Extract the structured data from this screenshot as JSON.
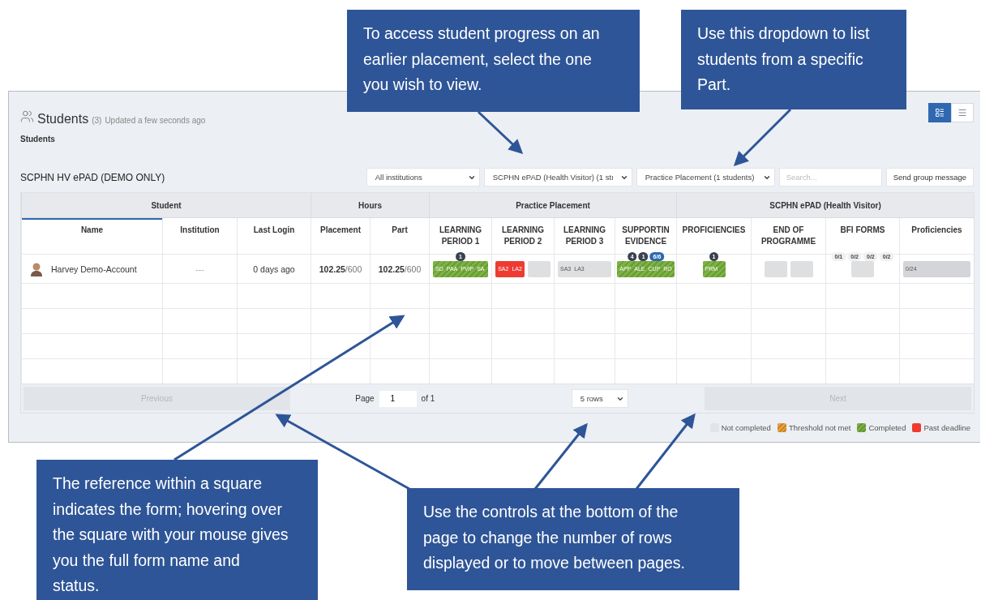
{
  "annotations": [
    {
      "text": "To access student progress on an earlier placement, select the one you wish to view."
    },
    {
      "text": "Use this dropdown to list students from a specific Part."
    },
    {
      "text": "The reference within a square indicates the form; hovering over the square with your mouse gives you the full form name and status."
    },
    {
      "text": "Use the controls at the bottom of the page to change the number of rows displayed or to move between pages."
    }
  ],
  "header": {
    "title": "Students",
    "count": "(3)",
    "updated": "Updated a few seconds ago",
    "subtitle": "Students"
  },
  "view_toggles": [
    {
      "kind": "cards",
      "selected": true
    },
    {
      "kind": "list",
      "selected": false
    }
  ],
  "programme": "SCPHN HV ePAD (DEMO ONLY)",
  "filters": [
    {
      "kind": "select",
      "value": "All institutions"
    },
    {
      "kind": "select",
      "value": "SCPHN ePAD (Health Visitor) (1 stı"
    },
    {
      "kind": "select",
      "value": "Practice Placement (1 students)"
    },
    {
      "kind": "search",
      "placeholder": "Search..."
    },
    {
      "kind": "button",
      "label": "Send group message"
    }
  ],
  "table": {
    "groups": [
      {
        "label": "Student",
        "columns": [
          {
            "label": "Name",
            "sorted": true
          },
          {
            "label": "Institution",
            "sorted": false
          },
          {
            "label": "Last Login",
            "sorted": false
          }
        ]
      },
      {
        "label": "Hours",
        "columns": [
          {
            "label": "Placement",
            "sorted": false
          },
          {
            "label": "Part",
            "sorted": false
          }
        ]
      },
      {
        "label": "Practice Placement",
        "columns": [
          {
            "label": "LEARNING PERIOD 1",
            "sorted": false
          },
          {
            "label": "LEARNING PERIOD 2",
            "sorted": false
          },
          {
            "label": "LEARNING PERIOD 3",
            "sorted": false
          },
          {
            "label": "SUPPORTIN EVIDENCE",
            "sorted": false
          }
        ]
      },
      {
        "label": "SCPHN ePAD (Health Visitor)",
        "columns": [
          {
            "label": "PROFICIENCIES",
            "sorted": false
          },
          {
            "label": "END OF PROGRAMME",
            "sorted": false
          },
          {
            "label": "BFI FORMS",
            "sorted": false
          },
          {
            "label": "Proficiencies",
            "sorted": false
          }
        ]
      }
    ],
    "rows": [
      {
        "cells": [
          {
            "kind": "name",
            "text": "Harvey Demo-Account"
          },
          {
            "kind": "muted",
            "text": "---"
          },
          {
            "kind": "text",
            "text": "0 days ago"
          },
          {
            "kind": "hours",
            "value": "102.25",
            "total": "/600"
          },
          {
            "kind": "hours",
            "value": "102.25",
            "total": "/600"
          },
          {
            "kind": "chips",
            "chips": [
              {
                "color": "#7cb342",
                "striped": true,
                "labels": [
                  "SD",
                  "PAA",
                  "PVIP",
                  "SA"
                ],
                "badges": [
                  {
                    "text": "1",
                    "color": "#3a4250"
                  }
                ]
              }
            ]
          },
          {
            "kind": "chips",
            "chips": [
              {
                "color": "#ee3b32",
                "striped": false,
                "labels": [
                  "SA2",
                  "LA2"
                ]
              },
              {
                "color": "#dedfe1",
                "striped": false
              }
            ]
          },
          {
            "kind": "chips",
            "chips": [
              {
                "color": "#dedfe1",
                "striped": false,
                "labels": [
                  "SA3",
                  "LA3"
                ]
              }
            ]
          },
          {
            "kind": "chips",
            "chips": [
              {
                "color": "#7cb342",
                "striped": true,
                "labels": [
                  "APP",
                  "ALE",
                  "CUP",
                  "RO"
                ],
                "badges": [
                  {
                    "text": "4",
                    "color": "#3a4250"
                  },
                  {
                    "text": "1",
                    "color": "#3a4250"
                  },
                  {
                    "text": "6/6",
                    "color": "#2f68b0"
                  }
                ]
              }
            ]
          },
          {
            "kind": "chips",
            "chips": [
              {
                "color": "#7cb342",
                "striped": true,
                "labels": [
                  "PRM"
                ],
                "badges": [
                  {
                    "text": "1",
                    "color": "#3a4250"
                  }
                ]
              }
            ]
          },
          {
            "kind": "chips",
            "chips": [
              {
                "color": "#dedfe1",
                "striped": false
              },
              {
                "color": "#dedfe1",
                "striped": false
              }
            ]
          },
          {
            "kind": "chips",
            "chips": [
              {
                "color": "#dedfe1",
                "striped": false,
                "badges": [
                  {
                    "text": "0/1",
                    "color": "#f0f0f0"
                  },
                  {
                    "text": "0/2",
                    "color": "#f0f0f0"
                  },
                  {
                    "text": "0/2",
                    "color": "#f0f0f0"
                  },
                  {
                    "text": "0/2",
                    "color": "#f0f0f0"
                  }
                ]
              }
            ]
          },
          {
            "kind": "chips",
            "chips": [
              {
                "color": "#d3d5d8",
                "striped": false,
                "labels": [
                  "0/24"
                ]
              }
            ]
          }
        ]
      }
    ]
  },
  "pagination": {
    "previous": {
      "label": "Previous",
      "disabled": true
    },
    "page_label": "Page",
    "page": "1",
    "of": "of 1",
    "rows": "5 rows",
    "next": {
      "label": "Next",
      "disabled": true
    }
  },
  "legend": [
    {
      "label": "Not completed",
      "color": "#e2e4e8",
      "striped": false
    },
    {
      "label": "Threshold not met",
      "color": "#f0a23a",
      "striped": true
    },
    {
      "label": "Completed",
      "color": "#7cb342",
      "striped": true
    },
    {
      "label": "Past deadline",
      "color": "#ee3b32",
      "striped": false
    }
  ]
}
